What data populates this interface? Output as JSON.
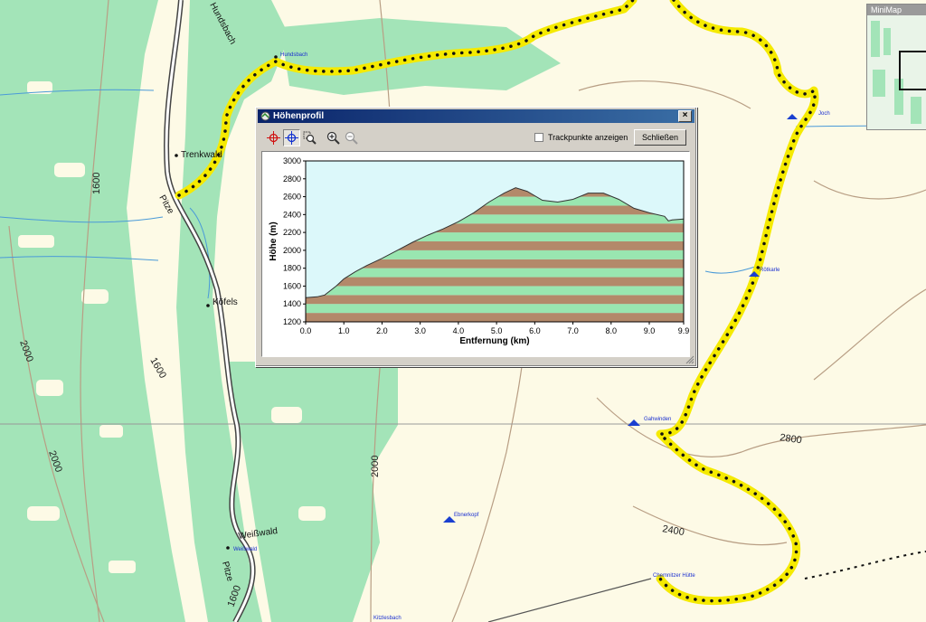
{
  "map": {
    "contour_labels": [
      "1600",
      "2000",
      "1600",
      "2000",
      "2000",
      "2400",
      "2800",
      "1600"
    ],
    "place_labels": [
      "Trenkwald",
      "Köfels",
      "Weißwald"
    ],
    "road_labels": [
      "Hundsbach",
      "Pitze",
      "Pitze"
    ],
    "poi_labels": [
      "Hundsbach",
      "Rötkarle",
      "Ebnerkopf",
      "Weißwald",
      "Kitzlesbach",
      "Chemnitzer Hütte",
      "Gahwinden",
      "Joch"
    ]
  },
  "minimap": {
    "title": "MiniMap"
  },
  "dialog": {
    "title": "Höhenprofil",
    "close_glyph": "×",
    "checkbox_label": "Trackpunkte anzeigen",
    "close_button": "Schließen"
  },
  "colors": {
    "band_brown": "#b3896a",
    "band_green": "#99e6b0",
    "sky": "#dcf8fa",
    "track": "#f5ea00"
  },
  "chart_data": {
    "type": "area",
    "xlabel": "Entfernung  (km)",
    "ylabel": "Höhe (m)",
    "xlim": [
      0,
      9.9
    ],
    "ylim": [
      1200,
      3000
    ],
    "x_ticks": [
      "0.0",
      "1.0",
      "2.0",
      "3.0",
      "4.0",
      "5.0",
      "6.0",
      "7.0",
      "8.0",
      "9.0",
      "9.9"
    ],
    "y_ticks": [
      "1200",
      "1400",
      "1600",
      "1800",
      "2000",
      "2200",
      "2400",
      "2600",
      "2800",
      "3000"
    ],
    "series": [
      {
        "x": [
          0.0,
          0.3,
          0.5,
          0.8,
          1.0,
          1.3,
          1.6,
          2.0,
          2.4,
          2.8,
          3.2,
          3.6,
          4.0,
          4.4,
          4.8,
          5.2,
          5.5,
          5.8,
          6.2,
          6.6,
          7.0,
          7.4,
          7.8,
          8.2,
          8.6,
          9.0,
          9.4,
          9.5,
          9.6,
          9.9
        ],
        "y": [
          1470,
          1480,
          1500,
          1600,
          1680,
          1760,
          1830,
          1910,
          2000,
          2090,
          2170,
          2240,
          2320,
          2420,
          2540,
          2640,
          2700,
          2660,
          2560,
          2540,
          2570,
          2640,
          2640,
          2570,
          2470,
          2420,
          2380,
          2330,
          2340,
          2350
        ]
      }
    ]
  }
}
